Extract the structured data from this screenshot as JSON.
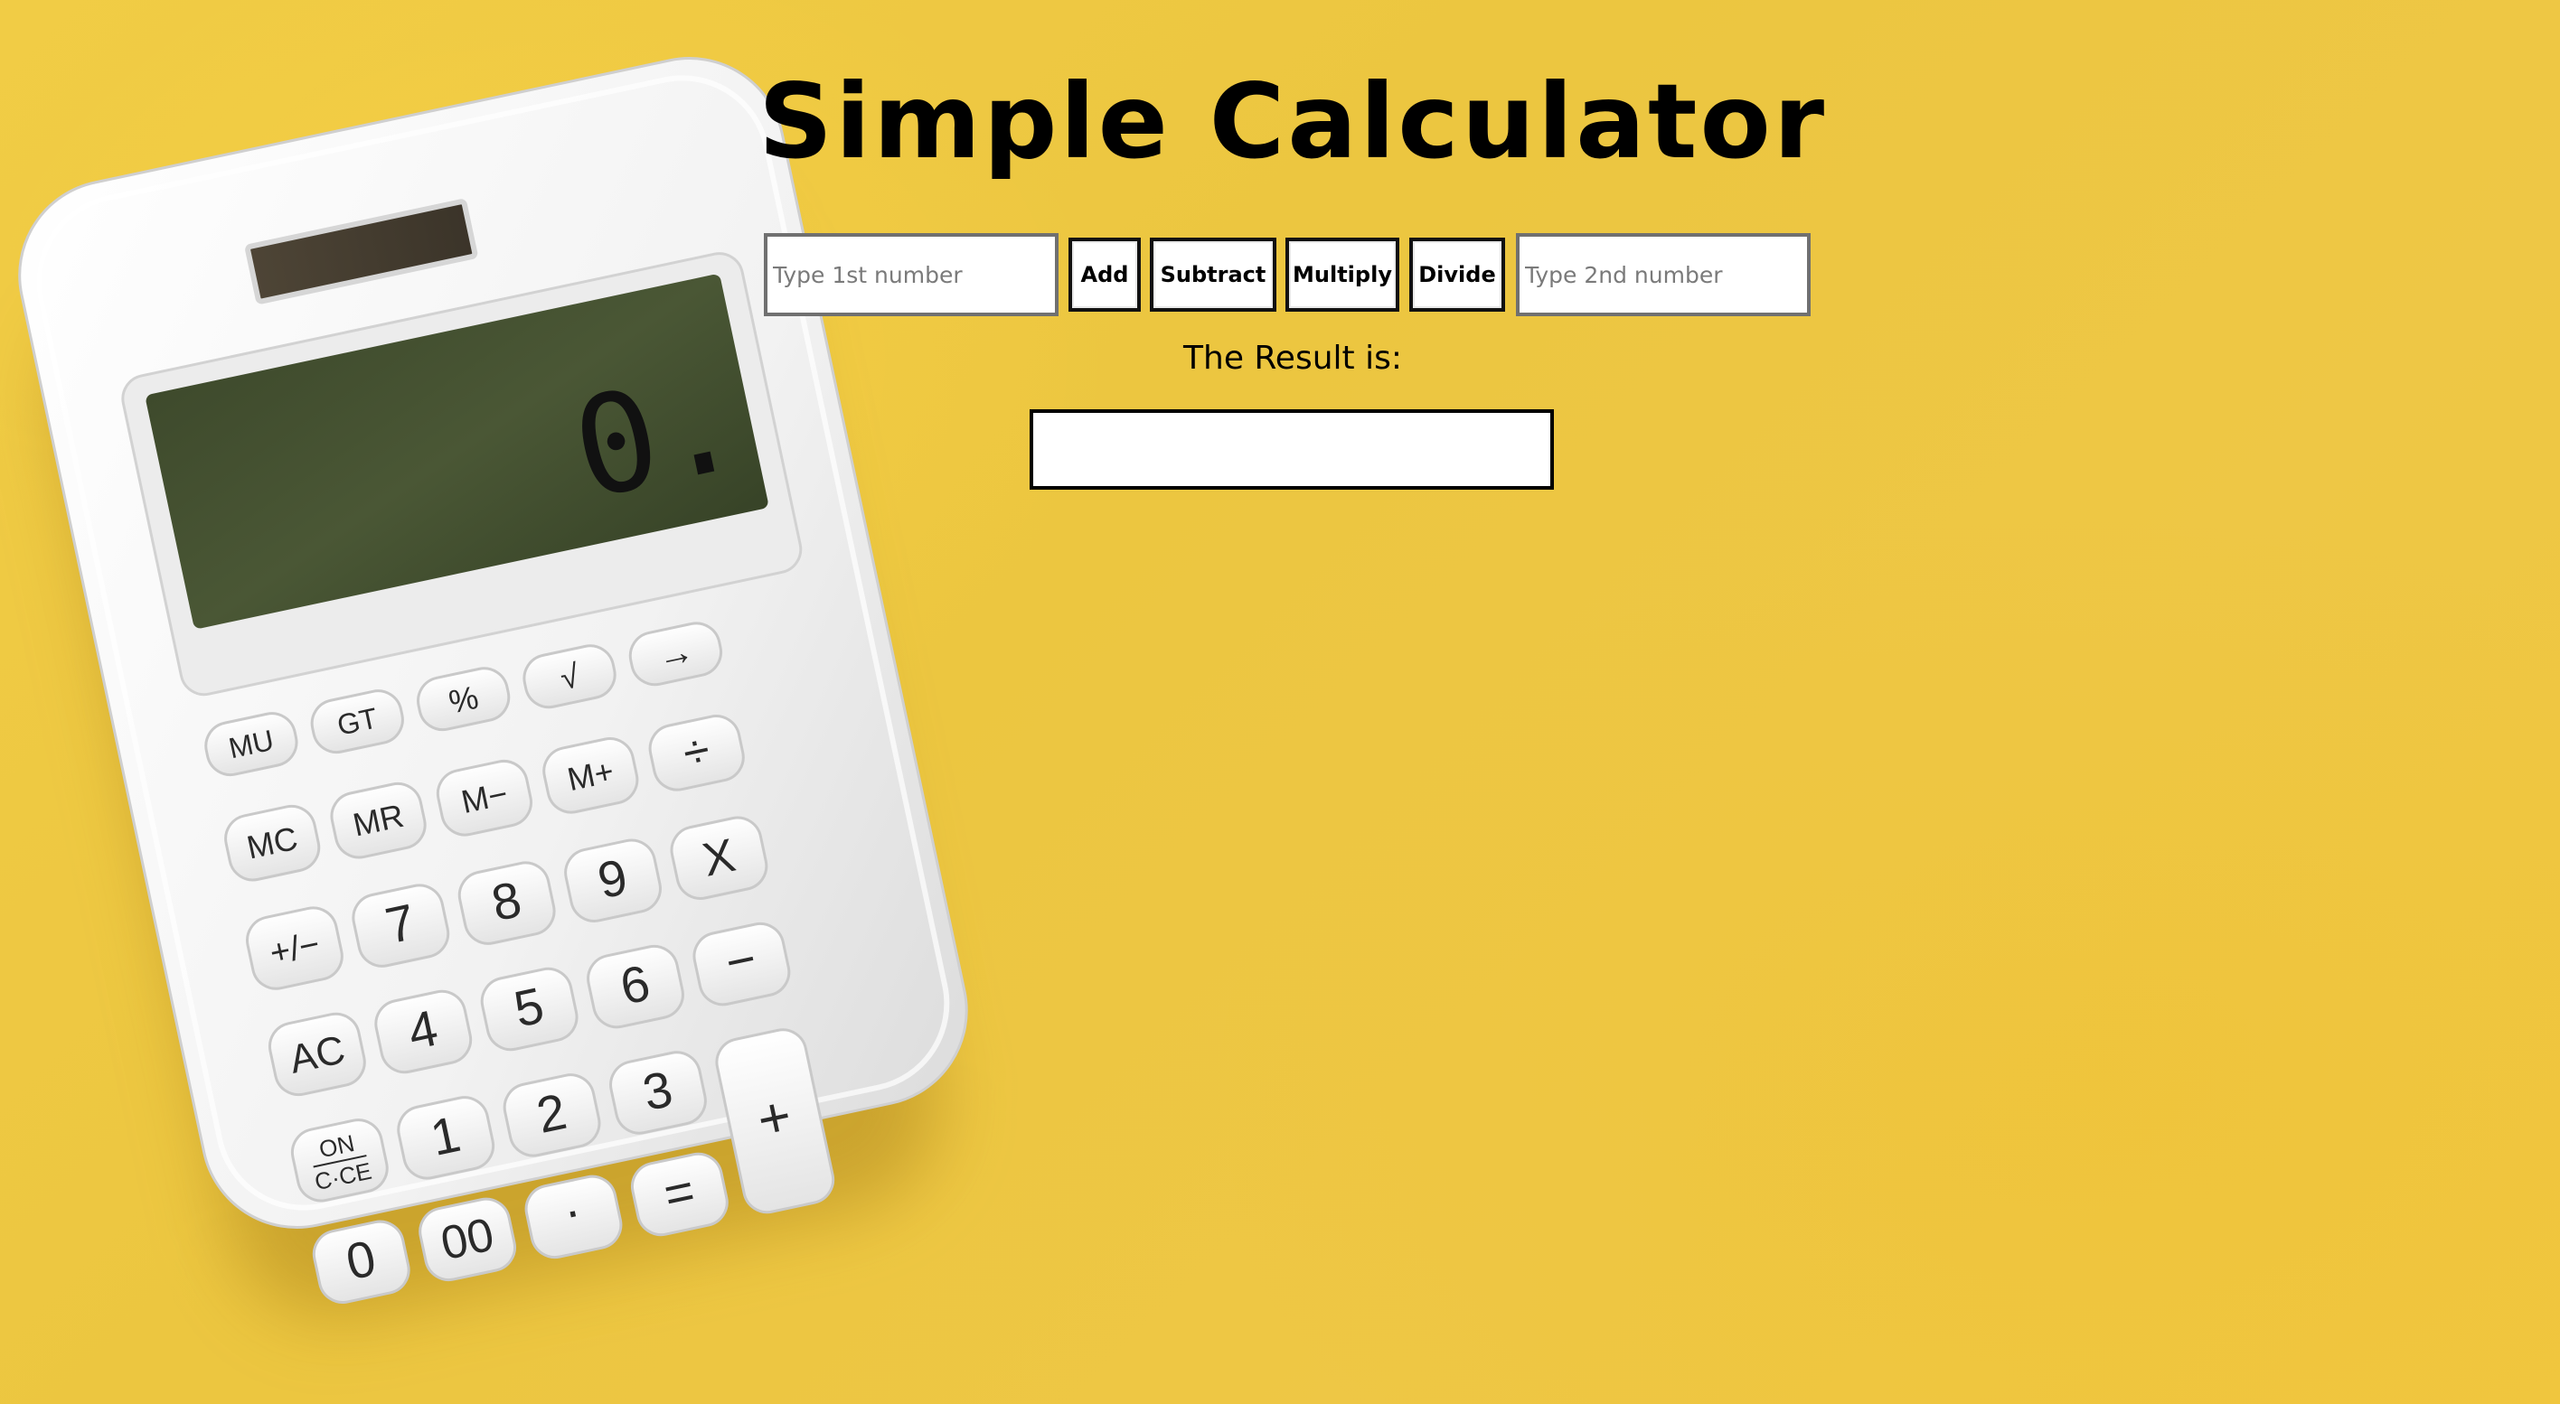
{
  "page": {
    "title": "Simple Calculator",
    "background_color": "#efc843"
  },
  "inputs": {
    "first_placeholder": "Type 1st number",
    "second_placeholder": "Type 2nd number"
  },
  "operations": {
    "add": "Add",
    "subtract": "Subtract",
    "multiply": "Multiply",
    "divide": "Divide"
  },
  "result": {
    "label": "The Result is:",
    "value": ""
  },
  "photo": {
    "subject": "white desk calculator on yellow background",
    "display_value": "0.",
    "keys": {
      "arrow": "→",
      "sqrt": "√",
      "percent": "%",
      "gt": "GT",
      "mu": "MU",
      "divide": "÷",
      "mplus": "M+",
      "mminus": "M−",
      "mr": "MR",
      "mc": "MC",
      "times": "X",
      "nine": "9",
      "eight": "8",
      "seven": "7",
      "plusminus": "+/−",
      "minus": "−",
      "six": "6",
      "five": "5",
      "four": "4",
      "ac": "AC",
      "plus": "+",
      "three": "3",
      "two": "2",
      "one": "1",
      "on_top": "ON",
      "on_bottom": "C·CE",
      "equals": "=",
      "dot": "·",
      "double_zero": "00",
      "zero": "0"
    }
  }
}
